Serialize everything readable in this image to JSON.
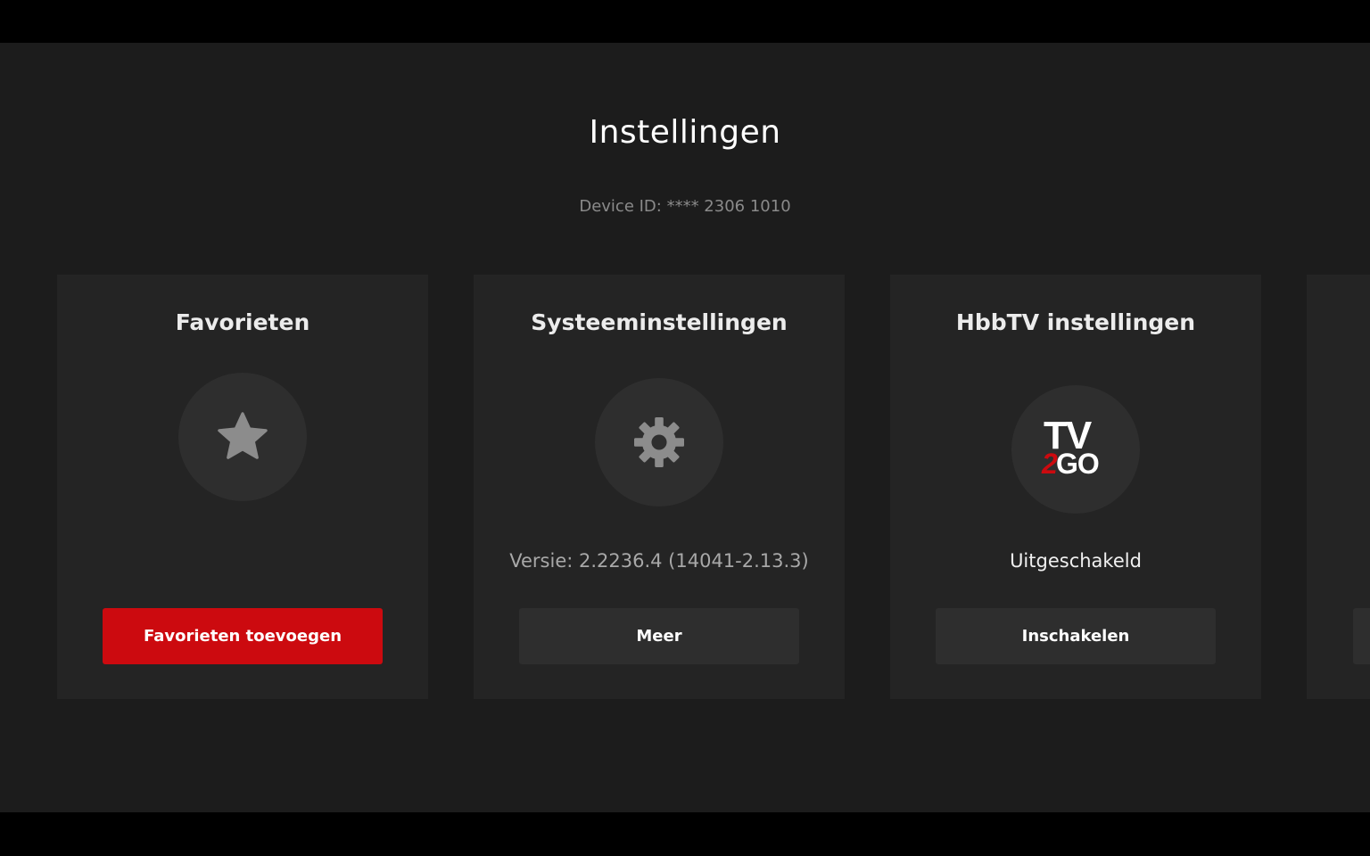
{
  "header": {
    "title": "Instellingen",
    "device_id": "Device ID: **** 2306 1010"
  },
  "colors": {
    "background": "#1c1c1c",
    "card": "#242424",
    "accent_red": "#cc0a0f",
    "secondary_button": "#2e2e2e"
  },
  "cards": [
    {
      "title": "Favorieten",
      "icon": "star-icon",
      "status": "",
      "button_label": "Favorieten toevoegen"
    },
    {
      "title": "Systeeminstellingen",
      "icon": "gear-icon",
      "status": "Versie: 2.2236.4 (14041-2.13.3)",
      "button_label": "Meer"
    },
    {
      "title": "HbbTV instellingen",
      "icon": "tv2go-logo",
      "logo_text": {
        "top": "TV",
        "two": "2",
        "go": "GO"
      },
      "status": "Uitgeschakeld",
      "button_label": "Inschakelen"
    }
  ]
}
